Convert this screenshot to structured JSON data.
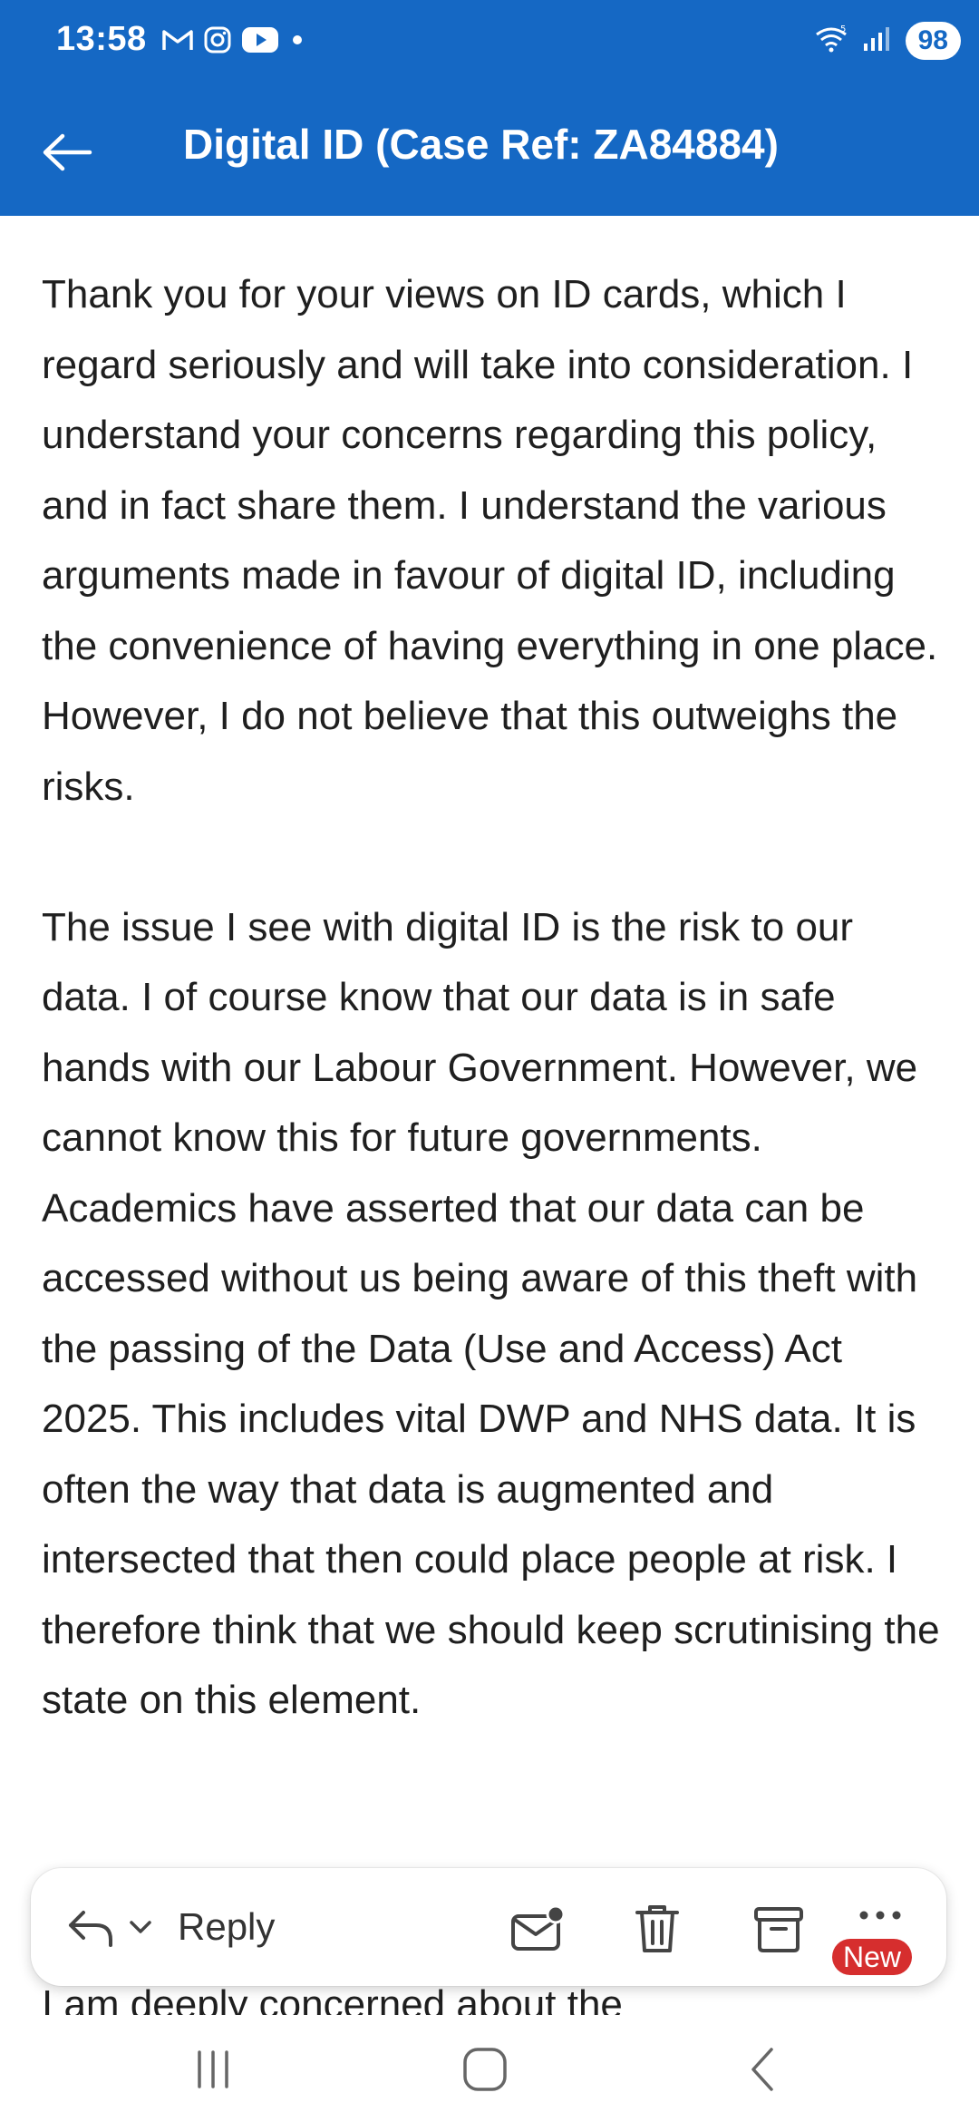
{
  "status_bar": {
    "time": "13:58",
    "notification_icons": [
      "gmail-icon",
      "instagram-icon",
      "youtube-icon",
      "dot-icon"
    ],
    "system_icons": [
      "wifi-icon",
      "signal-icon"
    ],
    "battery": "98"
  },
  "app_bar": {
    "title": "Digital ID (Case Ref: ZA84884)",
    "back_icon": "arrow-left-icon",
    "background": "#1568c4"
  },
  "message": {
    "paragraphs": [
      "Thank you for your views on ID cards, which I regard seriously and will take into consideration. I understand your concerns regarding this policy, and in fact share them. I understand the various arguments made in favour of digital ID, including the convenience of having everything in one place. However, I do not believe that this outweighs the risks.",
      "The issue I see with digital ID is the risk to our data. I of course know that our data is in safe hands with our Labour Government. However, we cannot know this for future governments. Academics have asserted that our data can be accessed without us being aware of this theft with the passing of the Data (Use and Access) Act 2025. This includes vital DWP and NHS data. It is often the way that data is augmented and intersected that then could place people at risk. I therefore think that we should keep scrutinising the state on this element."
    ],
    "partial_line": "I am deeply concerned about the"
  },
  "action_bar": {
    "reply_label": "Reply",
    "icons": [
      "reply-icon",
      "chevron-down-icon",
      "mark-unread-icon",
      "delete-icon",
      "archive-icon",
      "more-icon"
    ],
    "new_badge": "New",
    "badge_color": "#d62e2e"
  },
  "nav_bar": {
    "icons": [
      "recent-apps-icon",
      "home-icon",
      "back-icon"
    ]
  }
}
